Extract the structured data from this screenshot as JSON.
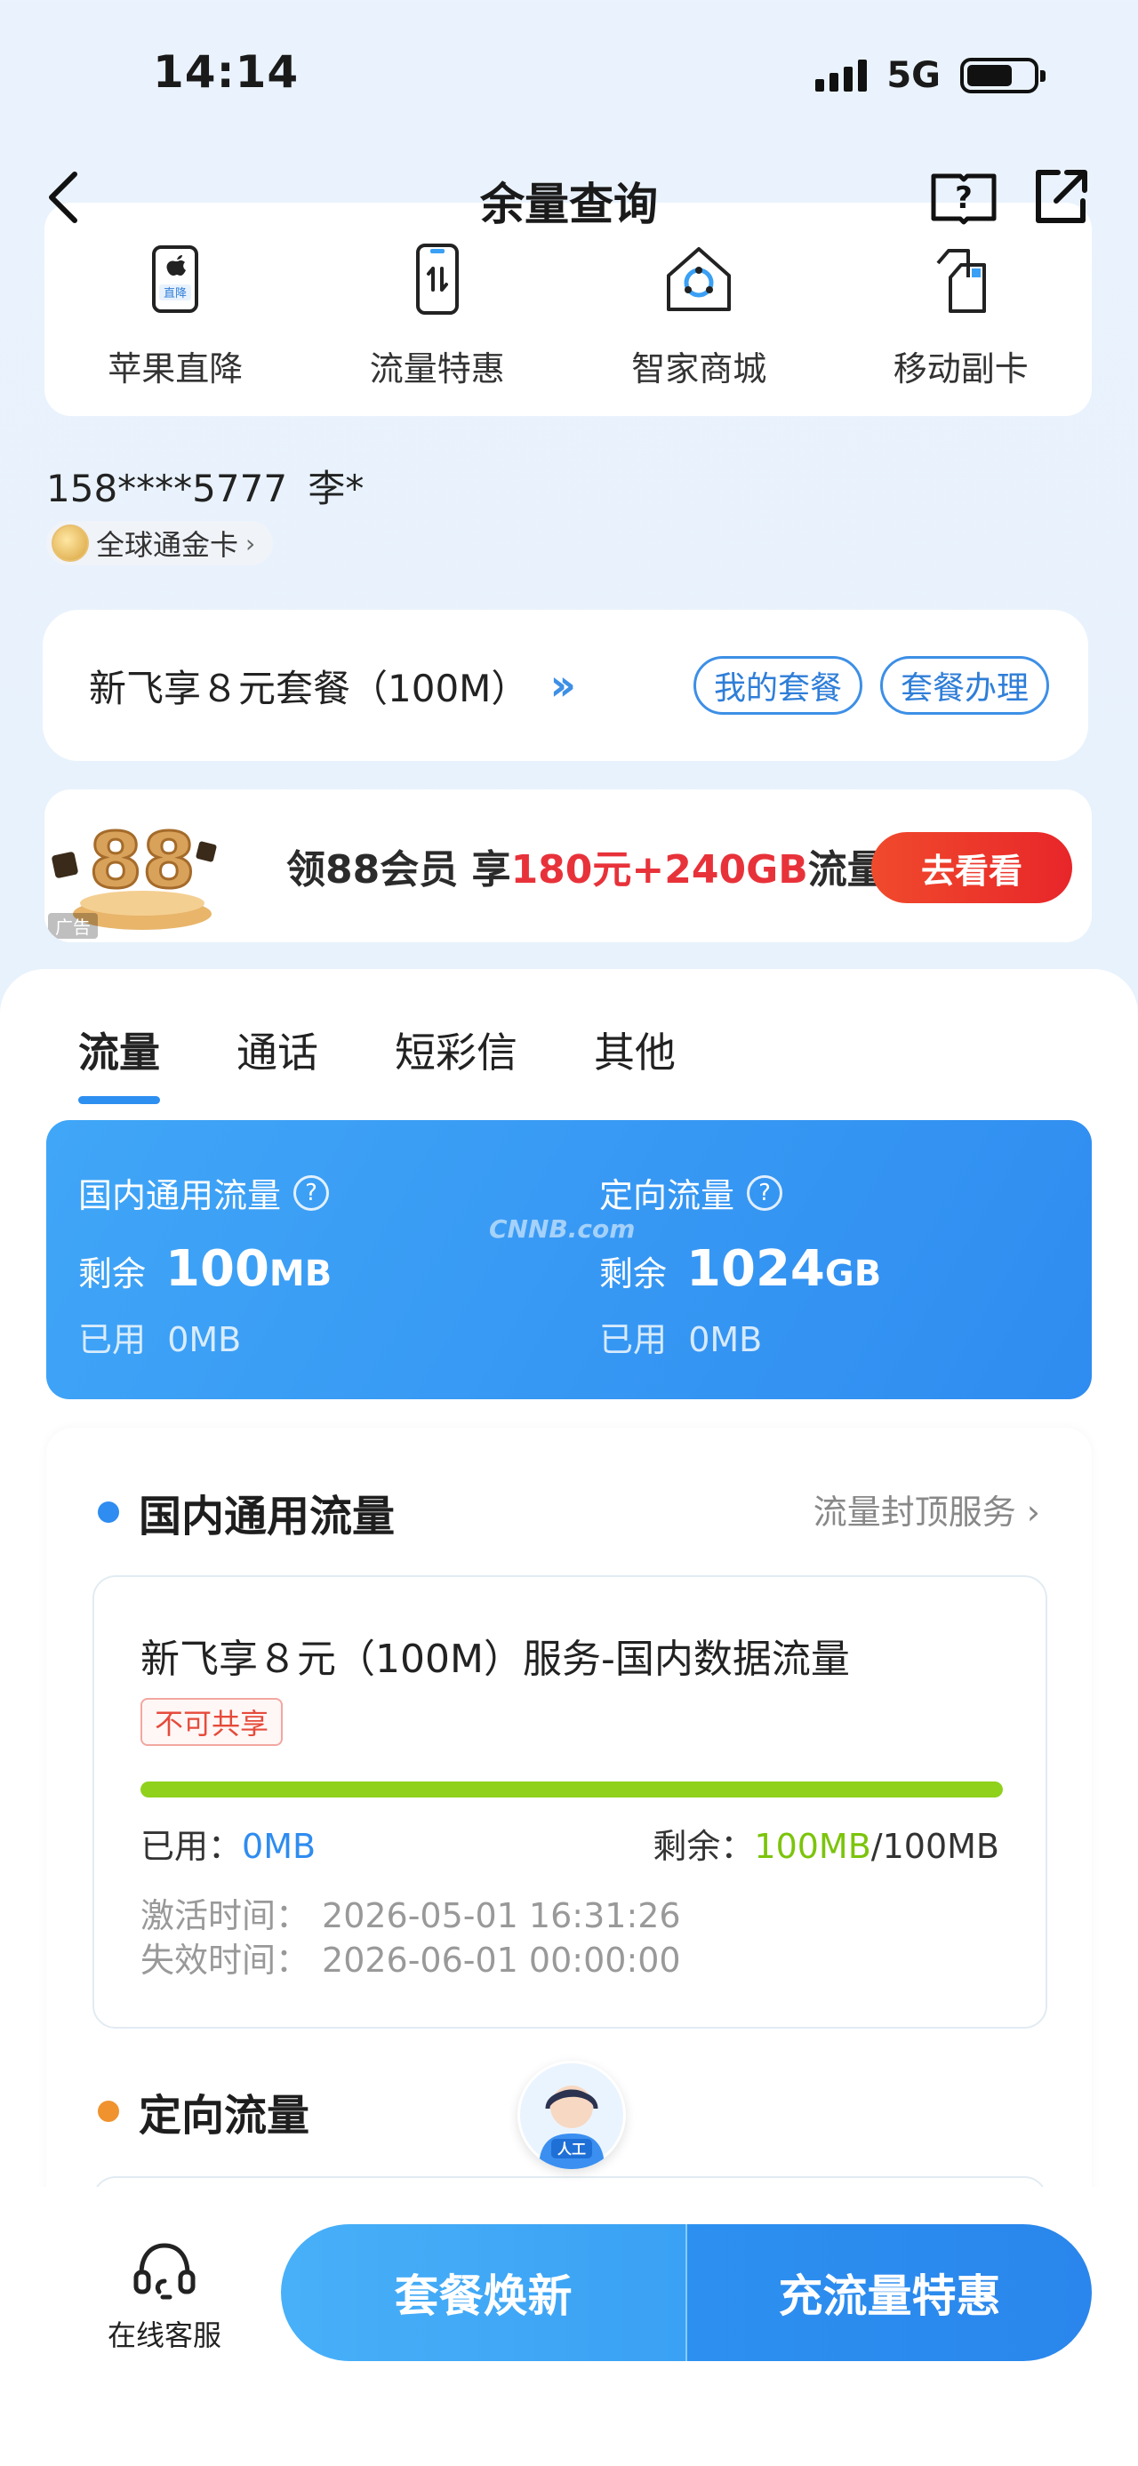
{
  "status": {
    "time": "14:14",
    "network": "5G"
  },
  "nav": {
    "title": "余量查询"
  },
  "shortcuts": [
    {
      "label": "苹果直降",
      "icon": "apple-phone-icon",
      "tag": "直降"
    },
    {
      "label": "流量特惠",
      "icon": "phone-data-icon"
    },
    {
      "label": "智家商城",
      "icon": "smart-home-icon"
    },
    {
      "label": "移动副卡",
      "icon": "sim-card-icon"
    }
  ],
  "user": {
    "phone": "158****5777",
    "name": "李*",
    "card_level": "全球通金卡"
  },
  "plan": {
    "name": "新飞享８元套餐（100M）",
    "my_plan": "我的套餐",
    "plan_service": "套餐办理"
  },
  "banner": {
    "badge": "88",
    "text_prefix": "领88会员 享",
    "text_highlight": "180元+240GB",
    "text_suffix": "流量",
    "button": "去看看",
    "ad_tag": "广告"
  },
  "tabs": [
    "流量",
    "通话",
    "短彩信",
    "其他"
  ],
  "active_tab": 0,
  "summary": {
    "watermark": "CNNB.com",
    "left": {
      "title": "国内通用流量",
      "remain_label": "剩余",
      "remain_value": "100",
      "remain_unit": "MB",
      "used_label": "已用",
      "used_value": "0MB"
    },
    "right": {
      "title": "定向流量",
      "remain_label": "剩余",
      "remain_value": "1024",
      "remain_unit": "GB",
      "used_label": "已用",
      "used_value": "0MB"
    }
  },
  "general": {
    "title": "国内通用流量",
    "cap_link": "流量封顶服务",
    "package": {
      "name": "新飞享８元（100M）服务-国内数据流量",
      "tag": "不可共享",
      "remain_fraction": 1.0,
      "used_label": "已用：",
      "used_value": "0MB",
      "remain_label": "剩余：",
      "remain_value": "100MB",
      "total": "/100MB",
      "activate_label": "激活时间：",
      "activate_time": "2026-05-01 16:31:26",
      "expire_label": "失效时间：",
      "expire_time": "2026-06-01 00:00:00"
    }
  },
  "directed": {
    "title": "定向流量"
  },
  "agent": {
    "label": "人工"
  },
  "bottom": {
    "service": "在线客服",
    "renew": "套餐焕新",
    "recharge": "充流量特惠"
  },
  "colors": {
    "accent": "#2f8cf0",
    "progress": "#8fd11b",
    "warning": "#e54b3b",
    "orange_dot": "#f0922e"
  }
}
